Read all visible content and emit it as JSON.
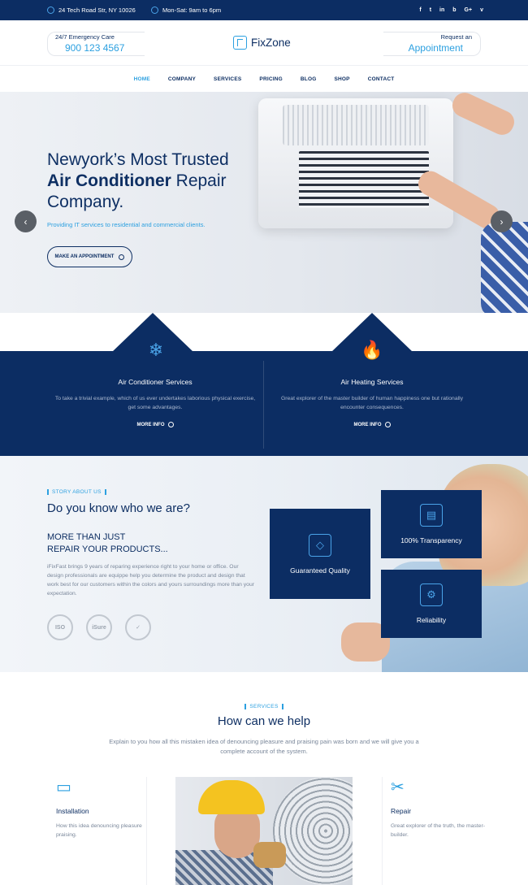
{
  "topbar": {
    "address": "24 Tech Road Str, NY 10026",
    "hours": "Mon-Sat: 9am to 6pm",
    "socials": [
      "f",
      "t",
      "in",
      "b",
      "G+",
      "v"
    ]
  },
  "header": {
    "emergency_label": "24/7 Emergency Care",
    "emergency_phone": "900 123 4567",
    "logo": "FixZone",
    "request_label": "Request an",
    "request_big": "Appointment"
  },
  "nav": {
    "items": [
      "HOME",
      "COMPANY",
      "SERVICES",
      "PRICING",
      "BLOG",
      "SHOP",
      "CONTACT"
    ],
    "active": "HOME"
  },
  "hero": {
    "line1": "Newyork’s Most Trusted",
    "line2_bold": "Air Conditioner",
    "line2_rest": " Repair",
    "line3": "Company.",
    "subtitle": "Providing IT services to residential and commercial clients.",
    "button": "MAKE AN APPOINTMENT",
    "prev": "‹",
    "next": "›"
  },
  "services_band": {
    "items": [
      {
        "icon": "snowflake-icon",
        "glyph": "❄",
        "title": "Air Conditioner Services",
        "desc": "To take a trivial example, which of us ever undertakes laborious physical exercise, get some advantages.",
        "more": "MORE INFO"
      },
      {
        "icon": "flame-icon",
        "glyph": "🔥",
        "title": "Air Heating Services",
        "desc": "Great explorer of the master builder of human happiness one but rationally encounter consequences.",
        "more": "MORE INFO"
      }
    ]
  },
  "about": {
    "eyebrow": "STORY ABOUT US",
    "heading": "Do you know who we are?",
    "sub1": "MORE THAN JUST",
    "sub2": "REPAIR YOUR PRODUCTS...",
    "paragraph": "iFixFast brings 9 years of reparing experience right to your home or office. Our design professionals are equippe help you determine the product and design that work best for our customers within the colors and yours surroundings more than your expectation.",
    "badges": [
      "ISO",
      "iSure",
      "✓"
    ],
    "features": [
      {
        "label": "Guaranteed Quality",
        "glyph": "◇"
      },
      {
        "label": "100% Transparency",
        "glyph": "▤"
      },
      {
        "label": "Reliability",
        "glyph": "⚙"
      }
    ]
  },
  "help": {
    "eyebrow": "SERVICES",
    "heading": "How can we help",
    "paragraph": "Explain to you how all this mistaken idea of denouncing pleasure and praising pain was born and we will give you a complete account of the system.",
    "cards": [
      {
        "icon": "ac-unit-icon",
        "glyph": "▭",
        "title": "Installation",
        "desc": "How this idea denouncing pleasure praising."
      },
      {
        "icon": "tools-icon",
        "glyph": "✂",
        "title": "Repair",
        "desc": "Great explorer of the truth, the master-builder."
      }
    ]
  },
  "colors": {
    "navy": "#0c2d63",
    "accent": "#2ca0e0"
  }
}
